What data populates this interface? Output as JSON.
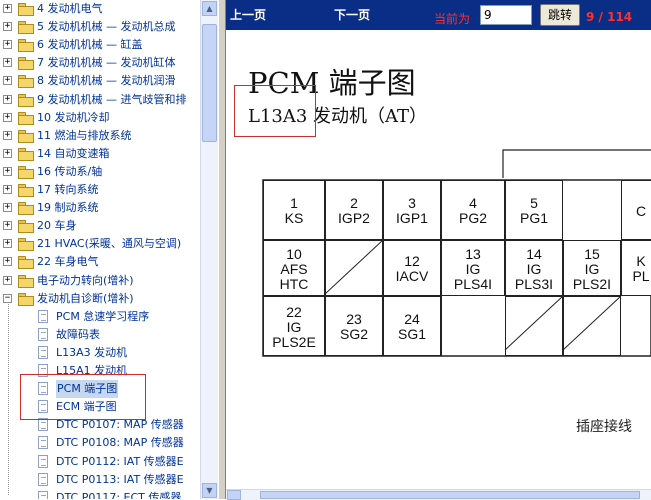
{
  "tree": {
    "items": [
      {
        "label": "4 发动机电气",
        "toggle": "+",
        "type": "folder"
      },
      {
        "label": "5 发动机机械 — 发动机总成",
        "toggle": "+",
        "type": "folder"
      },
      {
        "label": "6 发动机机械 — 缸盖",
        "toggle": "+",
        "type": "folder"
      },
      {
        "label": "7 发动机机械 — 发动机缸体",
        "toggle": "+",
        "type": "folder"
      },
      {
        "label": "8 发动机机械 — 发动机润滑",
        "toggle": "+",
        "type": "folder"
      },
      {
        "label": "9 发动机机械 — 进气歧管和排",
        "toggle": "+",
        "type": "folder"
      },
      {
        "label": "10 发动机冷却",
        "toggle": "+",
        "type": "folder"
      },
      {
        "label": "11 燃油与排放系统",
        "toggle": "+",
        "type": "folder"
      },
      {
        "label": "14 自动变速箱",
        "toggle": "+",
        "type": "folder"
      },
      {
        "label": "16 传动系/轴",
        "toggle": "+",
        "type": "folder"
      },
      {
        "label": "17 转向系统",
        "toggle": "+",
        "type": "folder"
      },
      {
        "label": "19 制动系统",
        "toggle": "+",
        "type": "folder"
      },
      {
        "label": "20 车身",
        "toggle": "+",
        "type": "folder"
      },
      {
        "label": "21 HVAC(采暖、通风与空调)",
        "toggle": "+",
        "type": "folder"
      },
      {
        "label": "22 车身电气",
        "toggle": "+",
        "type": "folder"
      },
      {
        "label": "电子动力转向(增补)",
        "toggle": "+",
        "type": "folder"
      },
      {
        "label": "发动机自诊断(增补)",
        "toggle": "−",
        "type": "folder"
      },
      {
        "label": "PCM 怠速学习程序",
        "type": "doc"
      },
      {
        "label": "故障码表",
        "type": "doc"
      },
      {
        "label": "L13A3 发动机",
        "type": "doc"
      },
      {
        "label": "L15A1 发动机",
        "type": "doc"
      },
      {
        "label": "PCM 端子图",
        "type": "doc",
        "selected": true
      },
      {
        "label": "ECM 端子图",
        "type": "doc"
      },
      {
        "label": "DTC P0107: MAP 传感器",
        "type": "doc"
      },
      {
        "label": "DTC P0108: MAP 传感器",
        "type": "doc"
      },
      {
        "label": "DTC P0112: IAT 传感器E",
        "type": "doc"
      },
      {
        "label": "DTC P0113: IAT 传感器E",
        "type": "doc"
      },
      {
        "label": "DTC P0117: ECT 传感器",
        "type": "doc"
      }
    ]
  },
  "toolbar": {
    "prev_label": "上一页",
    "next_label": "下一页",
    "current_label": "当前为",
    "page_value": "9",
    "jump_label": "跳转",
    "page_count": "9 / 114"
  },
  "document": {
    "title": "PCM 端子图",
    "subtitle": "L13A3 发动机（AT）",
    "footer_text": "插座接线",
    "terminals": [
      {
        "num": "1",
        "name": "KS"
      },
      {
        "num": "2",
        "name": "IGP2"
      },
      {
        "num": "3",
        "name": "IGP1"
      },
      {
        "num": "4",
        "name": "PG2"
      },
      {
        "num": "5",
        "name": "PG1"
      },
      {
        "num": "",
        "name": "C"
      },
      {
        "num": "10",
        "name": "AFS\nHTC"
      },
      {
        "num": "12",
        "name": "IACV"
      },
      {
        "num": "13",
        "name": "IG\nPLS4I"
      },
      {
        "num": "14",
        "name": "IG\nPLS3I"
      },
      {
        "num": "15",
        "name": "IG\nPLS2I"
      },
      {
        "num": "",
        "name": "K\nPL"
      },
      {
        "num": "22",
        "name": "IG\nPLS2E"
      },
      {
        "num": "23",
        "name": "SG2"
      },
      {
        "num": "24",
        "name": "SG1"
      }
    ]
  },
  "icons": {
    "folder": "folder-icon",
    "document": "document-icon",
    "expand": "plus-box-icon",
    "collapse": "minus-box-icon"
  },
  "colors": {
    "toolbar_bg": "#0a2e86",
    "tree_text": "#003399",
    "page_indicator": "#ff3030",
    "highlight_box": "#c9302c"
  }
}
